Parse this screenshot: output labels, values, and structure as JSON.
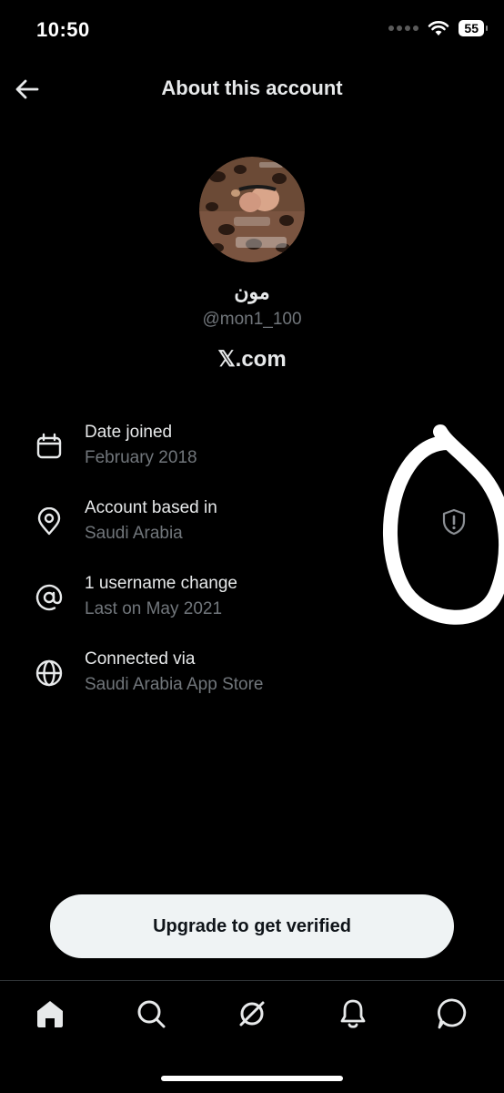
{
  "status_bar": {
    "time": "10:50",
    "battery": "55"
  },
  "header": {
    "title": "About this account"
  },
  "profile": {
    "display_name": "مون",
    "username": "@mon1_100",
    "site": "𝕏.com"
  },
  "info_items": [
    {
      "icon": "calendar-icon",
      "title": "Date joined",
      "value": "February 2018"
    },
    {
      "icon": "location-pin-icon",
      "title": "Account based in",
      "value": "Saudi Arabia"
    },
    {
      "icon": "at-sign-icon",
      "title": "1 username change",
      "value": "Last on May 2021"
    },
    {
      "icon": "globe-icon",
      "title": "Connected via",
      "value": "Saudi Arabia App Store"
    }
  ],
  "cta": {
    "label": "Upgrade to get verified"
  },
  "tabs": [
    "home-icon",
    "search-icon",
    "grok-icon",
    "notifications-icon",
    "messages-icon"
  ],
  "colors": {
    "background": "#000000",
    "primary_text": "#e7e9ea",
    "secondary_text": "#71767b",
    "button_bg": "#eff3f4",
    "button_text": "#0f1419"
  }
}
